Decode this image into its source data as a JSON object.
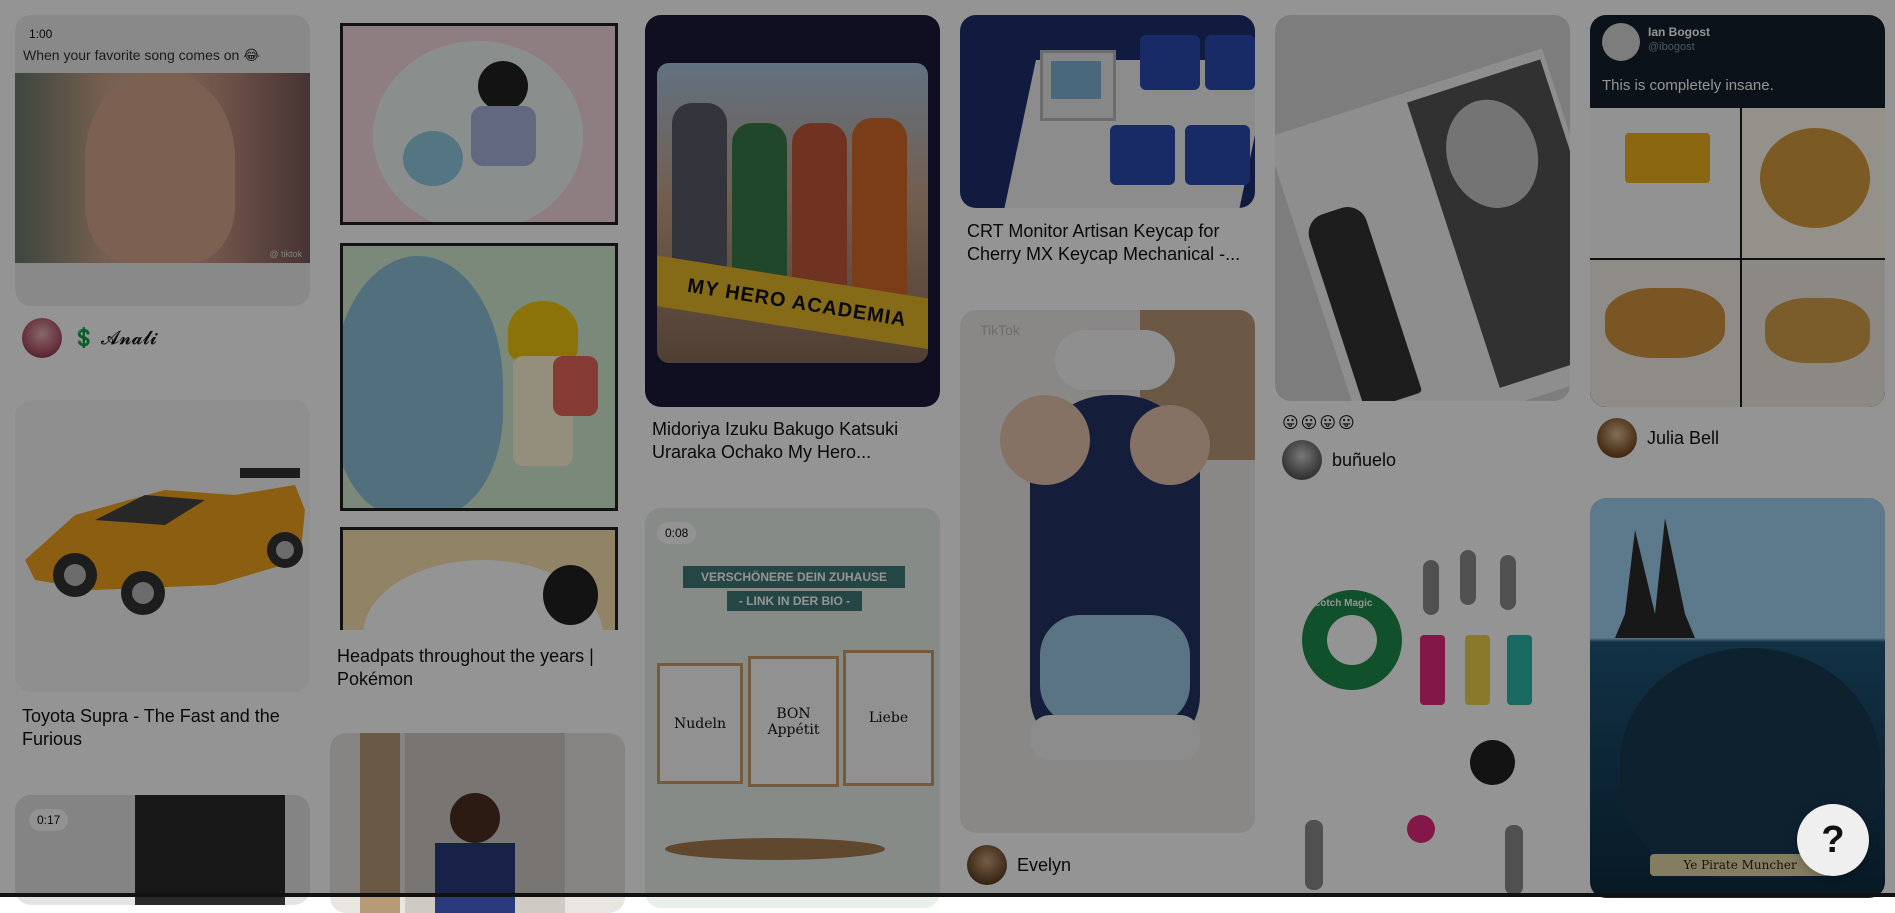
{
  "pins": {
    "song": {
      "duration": "1:00",
      "caption": "When your favorite song comes on 😂",
      "watermark": "@ tiktok",
      "author": "💲 𝓐𝓷𝓪𝓵𝓲"
    },
    "supra": {
      "title": "Toyota Supra - The Fast and the Furious"
    },
    "video3": {
      "duration": "0:17"
    },
    "headpats": {
      "title": "Headpats throughout the years | Pokémon"
    },
    "mha": {
      "title": "Midoriya Izuku Bakugo Katsuki Uraraka Ochako My Hero...",
      "banner": "MY HERO ACADEMIA"
    },
    "home": {
      "duration": "0:08",
      "line1": "VERSCHÖNERE DEIN ZUHAUSE",
      "line2": "- LINK IN DER BIO -",
      "poster1": "Nudeln",
      "poster2": "BON Appétit",
      "poster3": "Liebe"
    },
    "keycap": {
      "title": "CRT Monitor Artisan Keycap for Cherry MX Keycap Mechanical -..."
    },
    "sneaker": {
      "author": "Evelyn",
      "watermark": "TikTok"
    },
    "magazine": {
      "reactions": "😛😛😛😛",
      "author": "buñuelo"
    },
    "keys": {
      "tape_label": "Scotch Magic"
    },
    "tweet": {
      "name": "Ian Bogost",
      "handle": "@ibogost",
      "text": "This is completely insane.",
      "author": "Julia Bell"
    },
    "pirate": {
      "caption": "Ye Pirate Muncher"
    }
  },
  "help_button": {
    "label": "?"
  },
  "colors": {
    "overlay": "rgba(0,0,0,0.42)"
  }
}
